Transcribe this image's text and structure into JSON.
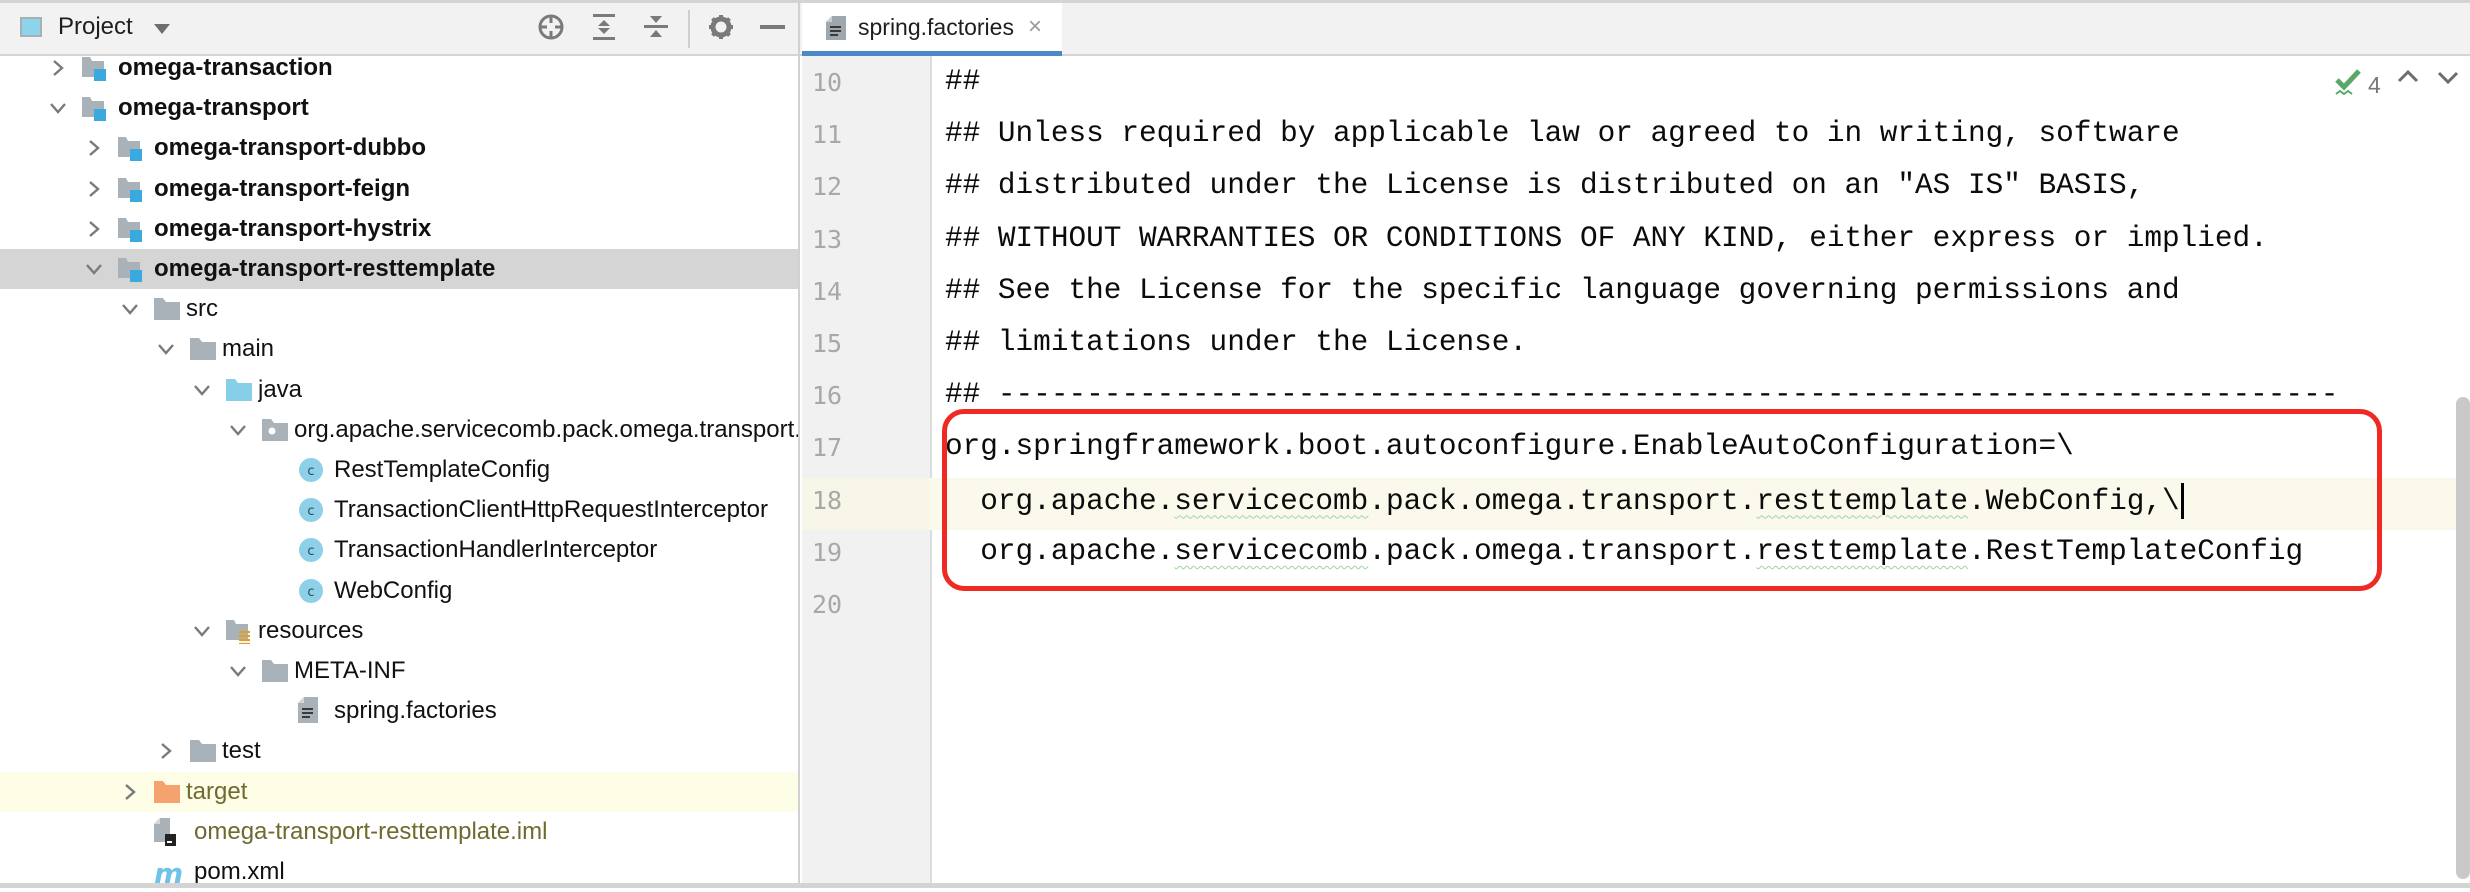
{
  "project_panel": {
    "title": "Project",
    "toolbar": {
      "locate": "locate-icon",
      "expand_all": "expand-all-icon",
      "collapse_all": "collapse-all-icon",
      "settings": "gear-icon",
      "hide": "minimize-icon"
    },
    "tree": [
      {
        "label": "omega-transaction",
        "depth": 0,
        "expander": "collapsed",
        "icon": "module-folder",
        "bold": true
      },
      {
        "label": "omega-transport",
        "depth": 0,
        "expander": "expanded",
        "icon": "module-folder",
        "bold": true
      },
      {
        "label": "omega-transport-dubbo",
        "depth": 1,
        "expander": "collapsed",
        "icon": "module-folder",
        "bold": true
      },
      {
        "label": "omega-transport-feign",
        "depth": 1,
        "expander": "collapsed",
        "icon": "module-folder",
        "bold": true
      },
      {
        "label": "omega-transport-hystrix",
        "depth": 1,
        "expander": "collapsed",
        "icon": "module-folder",
        "bold": true
      },
      {
        "label": "omega-transport-resttemplate",
        "depth": 1,
        "expander": "expanded",
        "icon": "module-folder",
        "bold": true,
        "selected": true
      },
      {
        "label": "src",
        "depth": 2,
        "expander": "expanded",
        "icon": "folder"
      },
      {
        "label": "main",
        "depth": 3,
        "expander": "expanded",
        "icon": "folder"
      },
      {
        "label": "java",
        "depth": 4,
        "expander": "expanded",
        "icon": "source-folder"
      },
      {
        "label": "org.apache.servicecomb.pack.omega.transport.resttemplate",
        "depth": 5,
        "expander": "expanded",
        "icon": "package"
      },
      {
        "label": "RestTemplateConfig",
        "depth": 6,
        "icon": "class"
      },
      {
        "label": "TransactionClientHttpRequestInterceptor",
        "depth": 6,
        "icon": "class"
      },
      {
        "label": "TransactionHandlerInterceptor",
        "depth": 6,
        "icon": "class"
      },
      {
        "label": "WebConfig",
        "depth": 6,
        "icon": "class"
      },
      {
        "label": "resources",
        "depth": 4,
        "expander": "expanded",
        "icon": "resources-folder"
      },
      {
        "label": "META-INF",
        "depth": 5,
        "expander": "expanded",
        "icon": "folder"
      },
      {
        "label": "spring.factories",
        "depth": 6,
        "icon": "text-file"
      },
      {
        "label": "test",
        "depth": 3,
        "expander": "collapsed",
        "icon": "folder"
      },
      {
        "label": "target",
        "depth": 2,
        "expander": "collapsed",
        "icon": "excluded-folder",
        "olive": true,
        "highlight": true
      },
      {
        "label": "omega-transport-resttemplate.iml",
        "depth": 2,
        "icon": "iml-file",
        "olive": true
      },
      {
        "label": "pom.xml",
        "depth": 2,
        "icon": "maven-file"
      }
    ]
  },
  "editor": {
    "tab": {
      "label": "spring.factories",
      "icon": "text-file-icon",
      "close": "×"
    },
    "inspection": {
      "icon": "check-typo-icon",
      "count": "4",
      "color": "#59a869"
    },
    "current_line": 18,
    "lines": [
      {
        "n": "10",
        "text": "##"
      },
      {
        "n": "11",
        "text": "## Unless required by applicable law or agreed to in writing, software"
      },
      {
        "n": "12",
        "text": "## distributed under the License is distributed on an \"AS IS\" BASIS,"
      },
      {
        "n": "13",
        "text": "## WITHOUT WARRANTIES OR CONDITIONS OF ANY KIND, either express or implied."
      },
      {
        "n": "14",
        "text": "## See the License for the specific language governing permissions and"
      },
      {
        "n": "15",
        "text": "## limitations under the License."
      },
      {
        "n": "16",
        "text": "## ----------------------------------------------------------------------------"
      },
      {
        "n": "17",
        "text": "org.springframework.boot.autoconfigure.EnableAutoConfiguration=\\"
      },
      {
        "n": "18",
        "segments": [
          "  org.apache.",
          "servicecomb",
          ".pack.omega.transport.",
          "resttemplate",
          ".WebConfig,\\"
        ]
      },
      {
        "n": "19",
        "segments": [
          "  org.apache.",
          "servicecomb",
          ".pack.omega.transport.",
          "resttemplate",
          ".RestTemplateConfig"
        ]
      },
      {
        "n": "20",
        "text": ""
      }
    ],
    "annotation": {
      "type": "rounded-rectangle",
      "color": "#ee2a22",
      "lines": [
        17,
        19
      ]
    }
  }
}
